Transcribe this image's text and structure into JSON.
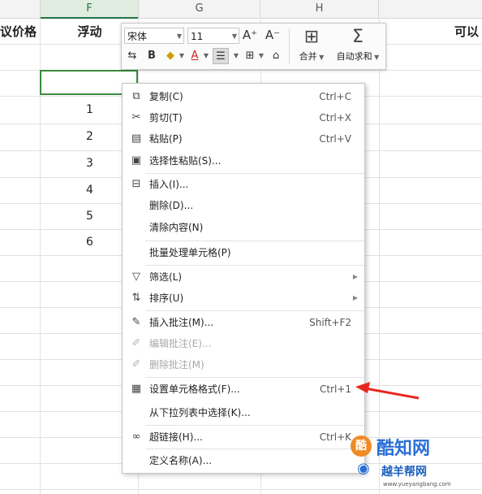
{
  "sheet": {
    "column_headers": [
      "F",
      "G",
      "H"
    ],
    "header_row": {
      "left_text": "议价格",
      "float_text": "浮动",
      "right_text": "可以"
    },
    "column_f_values": [
      "1",
      "2",
      "3",
      "4",
      "5",
      "6"
    ]
  },
  "mini_toolbar": {
    "font_name": "宋体",
    "font_size": "11",
    "increase_font_icon": "A⁺",
    "decrease_font_icon": "A⁻",
    "bold_label": "B",
    "font_color_label": "A",
    "merge_label": "合并",
    "autosum_label": "自动求和"
  },
  "context_menu": {
    "items": [
      {
        "label": "复制(C)",
        "shortcut": "Ctrl+C",
        "icon": "copy-icon",
        "disabled": false
      },
      {
        "label": "剪切(T)",
        "shortcut": "Ctrl+X",
        "icon": "scissors-icon",
        "disabled": false
      },
      {
        "label": "粘贴(P)",
        "shortcut": "Ctrl+V",
        "icon": "paste-icon",
        "disabled": false
      },
      {
        "label": "选择性粘贴(S)...",
        "shortcut": "",
        "icon": "paste-special-icon",
        "disabled": false
      },
      {
        "label": "插入(I)...",
        "shortcut": "",
        "icon": "insert-icon",
        "disabled": false
      },
      {
        "label": "删除(D)...",
        "shortcut": "",
        "icon": "",
        "disabled": false
      },
      {
        "label": "清除内容(N)",
        "shortcut": "",
        "icon": "",
        "disabled": false
      },
      {
        "label": "批量处理单元格(P)",
        "shortcut": "",
        "icon": "",
        "disabled": false
      },
      {
        "label": "筛选(L)",
        "shortcut": "",
        "icon": "filter-icon",
        "disabled": false,
        "submenu": true
      },
      {
        "label": "排序(U)",
        "shortcut": "",
        "icon": "sort-icon",
        "disabled": false,
        "submenu": true
      },
      {
        "label": "插入批注(M)...",
        "shortcut": "Shift+F2",
        "icon": "insert-comment-icon",
        "disabled": false
      },
      {
        "label": "编辑批注(E)...",
        "shortcut": "",
        "icon": "edit-comment-icon",
        "disabled": true
      },
      {
        "label": "删除批注(M)",
        "shortcut": "",
        "icon": "delete-comment-icon",
        "disabled": true
      },
      {
        "label": "设置单元格格式(F)...",
        "shortcut": "Ctrl+1",
        "icon": "format-cells-icon",
        "disabled": false
      },
      {
        "label": "从下拉列表中选择(K)...",
        "shortcut": "",
        "icon": "",
        "disabled": false
      },
      {
        "label": "超链接(H)...",
        "shortcut": "Ctrl+K",
        "icon": "link-icon",
        "disabled": false
      },
      {
        "label": "定义名称(A)...",
        "shortcut": "",
        "icon": "",
        "disabled": false
      }
    ]
  },
  "watermark": {
    "logo_char": "酷",
    "main_text": "酷知网",
    "sub_text": "越羊帮网",
    "url": "www.yueyangbang.com"
  },
  "colors": {
    "accent_green": "#217346",
    "arrow_red": "#e8281e",
    "watermark_blue": "#2a6fd6"
  }
}
